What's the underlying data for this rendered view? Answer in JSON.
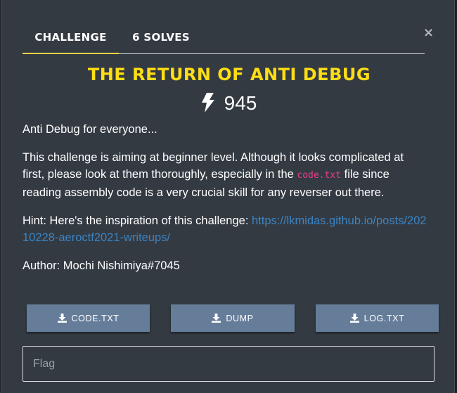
{
  "tabs": [
    {
      "label": "CHALLENGE",
      "active": true
    },
    {
      "label": "6 SOLVES",
      "active": false
    }
  ],
  "close_label": "×",
  "challenge": {
    "title": "THE RETURN OF ANTI DEBUG",
    "points": "945",
    "points_icon": "bolt-icon",
    "description": {
      "line1": "Anti Debug for everyone...",
      "para_before_code": "This challenge is aiming at beginner level. Although it looks complicated at first, please look at them thoroughly, especially in the ",
      "code": "code.txt",
      "para_after_code": " file since reading assembly code is a very crucial skill for any reverser out there.",
      "hint_prefix": "Hint: Here's the inspiration of this challenge: ",
      "hint_link": "https://lkmidas.github.io/posts/20210228-aeroctf2021-writeups/",
      "author": "Author: Mochi Nishimiya#7045"
    }
  },
  "files": [
    {
      "label": "CODE.TXT",
      "icon": "download-icon"
    },
    {
      "label": "DUMP",
      "icon": "download-icon"
    },
    {
      "label": "LOG.TXT",
      "icon": "download-icon"
    }
  ],
  "flag_input": {
    "placeholder": "Flag",
    "value": ""
  },
  "colors": {
    "title": "#fddd15",
    "accent": "#f5d447",
    "link": "#3a84c4",
    "code": "#e83e8c",
    "button": "#667d9a",
    "background": "#343a42"
  }
}
